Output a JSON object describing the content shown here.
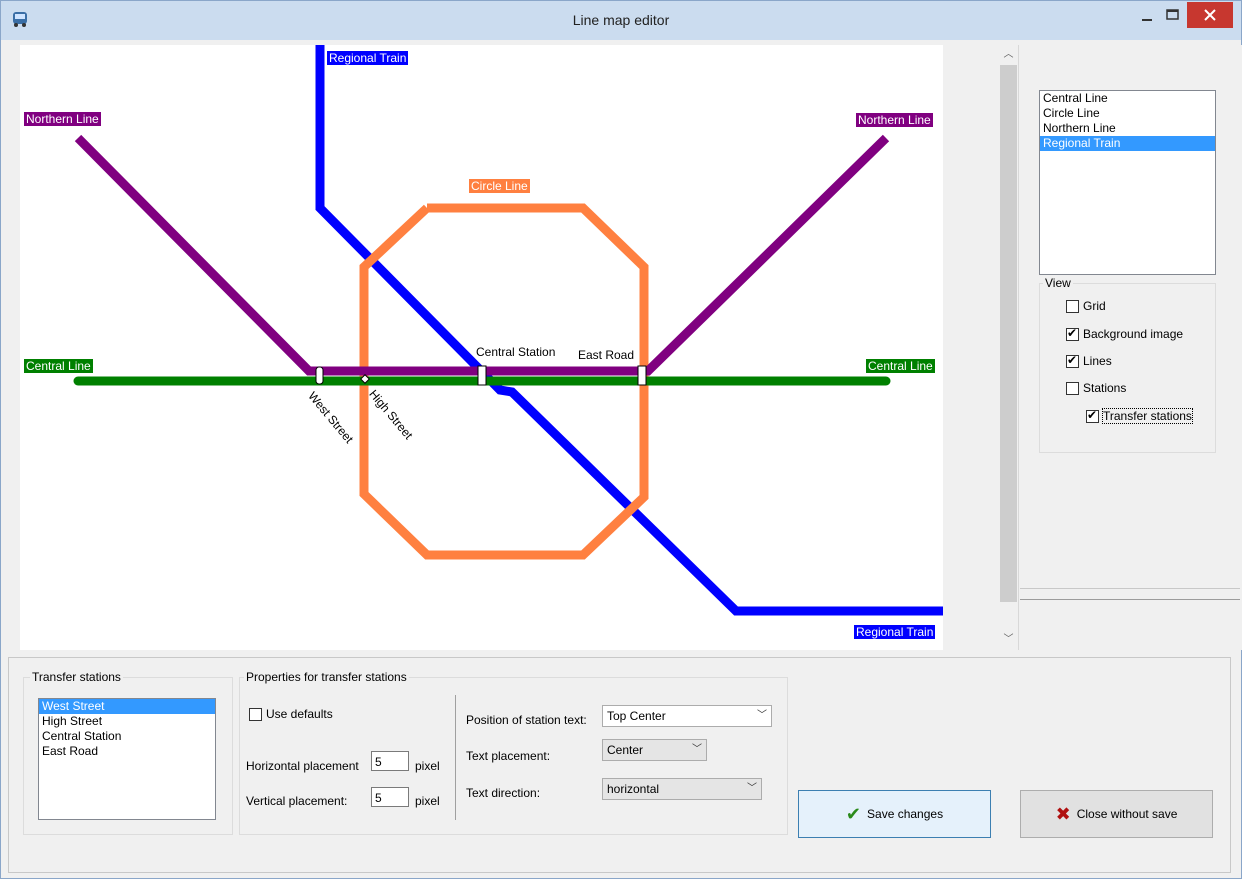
{
  "window": {
    "title": "Line map editor"
  },
  "map": {
    "line_labels": {
      "regional_top": "Regional Train",
      "regional_bottom": "Regional Train",
      "northern_left": "Northern Line",
      "northern_right": "Northern Line",
      "circle": "Circle Line",
      "central_left": "Central Line",
      "central_right": "Central Line"
    },
    "stations": {
      "central_station": "Central Station",
      "east_road": "East Road",
      "west_street": "West Street",
      "high_street": "High Street"
    },
    "colors": {
      "regional": "#0000ff",
      "northern": "#800080",
      "circle": "#ff8040",
      "central": "#008000"
    }
  },
  "lines_list": {
    "items": [
      "Central Line",
      "Circle Line",
      "Northern Line",
      "Regional Train"
    ],
    "selected": "Regional Train"
  },
  "view": {
    "title": "View",
    "grid": "Grid",
    "background_image": "Background image",
    "lines": "Lines",
    "stations": "Stations",
    "transfer_stations": "Transfer stations",
    "grid_checked": false,
    "background_image_checked": true,
    "lines_checked": true,
    "stations_checked": false,
    "transfer_stations_checked": true
  },
  "transfer_panel": {
    "title": "Transfer stations",
    "items": [
      "West Street",
      "High Street",
      "Central Station",
      "East Road"
    ],
    "selected": "West Street"
  },
  "properties": {
    "title": "Properties for transfer stations",
    "use_defaults": "Use defaults",
    "use_defaults_checked": false,
    "horizontal_label": "Horizontal placement",
    "horizontal_value": "5",
    "horizontal_unit": "pixel",
    "vertical_label": "Vertical placement:",
    "vertical_value": "5",
    "vertical_unit": "pixel",
    "position_label": "Position of station text:",
    "position_value": "Top Center",
    "text_placement_label": "Text placement:",
    "text_placement_value": "Center",
    "text_direction_label": "Text direction:",
    "text_direction_value": "horizontal"
  },
  "buttons": {
    "save": "Save changes",
    "close": "Close without save"
  }
}
